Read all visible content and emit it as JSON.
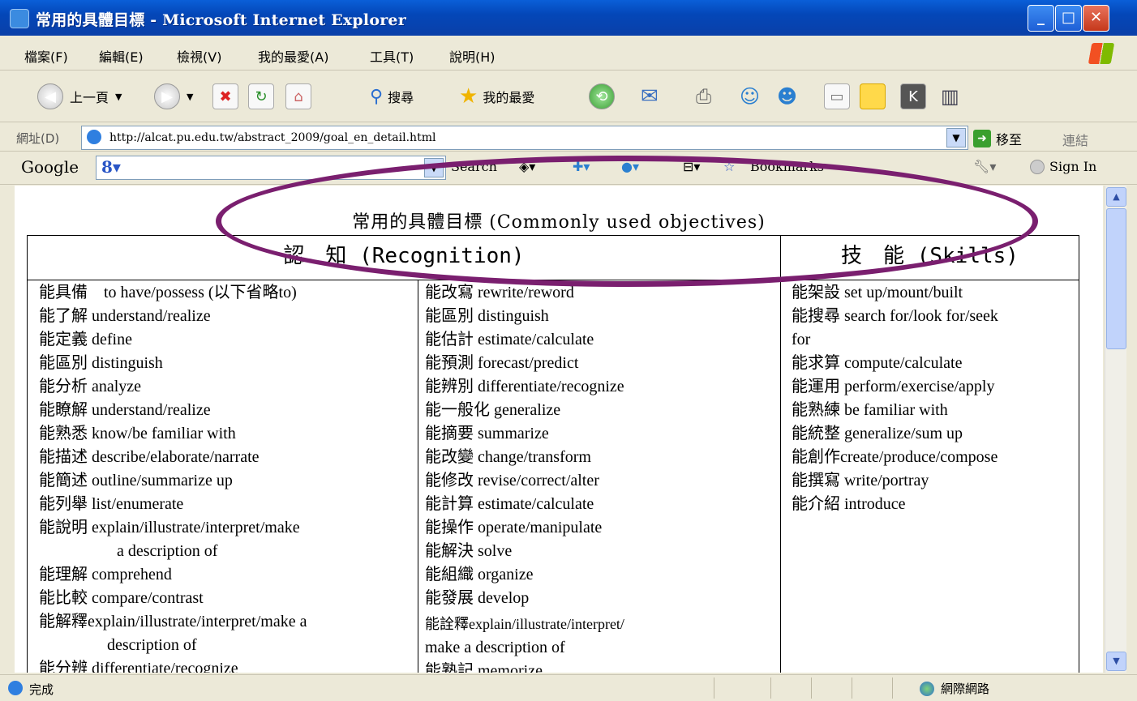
{
  "window": {
    "title": "常用的具體目標 - Microsoft Internet Explorer"
  },
  "menu": [
    "檔案(F)",
    "編輯(E)",
    "檢視(V)",
    "我的最愛(A)",
    "工具(T)",
    "說明(H)"
  ],
  "toolbar": {
    "back": "上一頁",
    "search": "搜尋",
    "favorites": "我的最愛"
  },
  "address": {
    "label": "網址(D)",
    "url": "http://alcat.pu.edu.tw/abstract_2009/goal_en_detail.html",
    "go": "移至",
    "links": "連結"
  },
  "google": {
    "logo": "Google",
    "search": "Search",
    "bookmarks": "Bookmarks",
    "signin": "Sign In"
  },
  "page": {
    "title": "常用的具體目標 (Commonly used objectives)",
    "recognition_header": "認　知 (Recognition)",
    "skills_header": "技　能 (Skills)",
    "col1": [
      "能具備　to have/possess (以下省略to)",
      "能了解 understand/realize",
      "能定義 define",
      "能區別 distinguish",
      "能分析 analyze",
      "能瞭解 understand/realize",
      "能熟悉 know/be familiar with",
      "能描述 describe/elaborate/narrate",
      "能簡述 outline/summarize up",
      "能列舉 list/enumerate",
      "能說明 explain/illustrate/interpret/make",
      "a description of",
      "能理解 comprehend",
      "能比較 compare/contrast",
      "能解釋explain/illustrate/interpret/make a",
      "description of",
      "能分辨 differentiate/recognize"
    ],
    "col2": [
      "能改寫 rewrite/reword",
      "能區別 distinguish",
      "能估計 estimate/calculate",
      "能預測 forecast/predict",
      "能辨別 differentiate/recognize",
      "能一般化 generalize",
      "能摘要 summarize",
      "能改變 change/transform",
      "能修改 revise/correct/alter",
      "能計算 estimate/calculate",
      "能操作 operate/manipulate",
      "能解決 solve",
      "能組織 organize",
      "能發展 develop",
      "能詮釋explain/illustrate/interpret/",
      "make a description of",
      "能熟記 memorize"
    ],
    "col3": [
      "能架設 set up/mount/built",
      "能搜尋 search for/look for/seek",
      "for",
      "能求算 compute/calculate",
      "能運用 perform/exercise/apply",
      "能熟練 be familiar with",
      "能統整 generalize/sum up",
      "能創作create/produce/compose",
      "能撰寫 write/portray",
      "能介紹 introduce"
    ]
  },
  "status": {
    "text": "完成",
    "zone": "網際網路"
  }
}
